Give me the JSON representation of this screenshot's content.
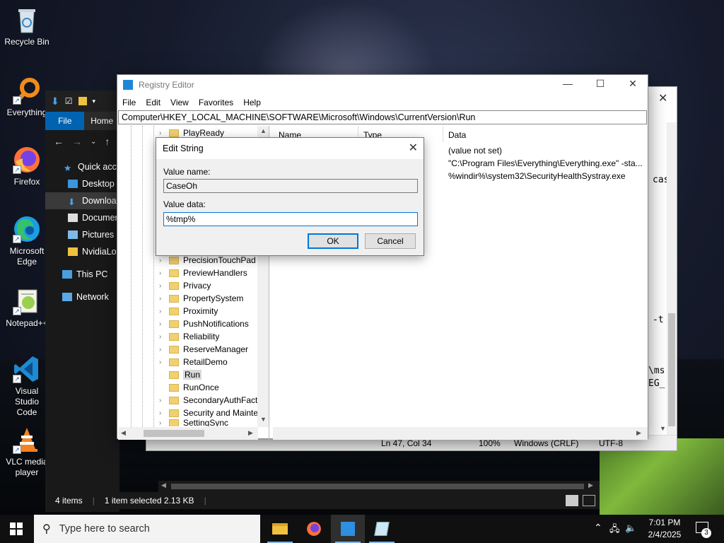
{
  "desktop": {
    "icons": [
      {
        "label": "Recycle Bin"
      },
      {
        "label": "Everything"
      },
      {
        "label": "Firefox"
      },
      {
        "label": "Microsoft Edge"
      },
      {
        "label": "Notepad++"
      },
      {
        "label": "Visual Studio Code"
      },
      {
        "label": "VLC media player"
      }
    ]
  },
  "explorer": {
    "file_tab": "File",
    "home_tab": "Home",
    "sidebar": [
      {
        "label": "Quick access"
      },
      {
        "label": "Desktop"
      },
      {
        "label": "Downloads"
      },
      {
        "label": "Documents"
      },
      {
        "label": "Pictures"
      },
      {
        "label": "NvidiaLogs"
      },
      {
        "label": "This PC"
      },
      {
        "label": "Network"
      }
    ],
    "status": {
      "items": "4 items",
      "selected": "1 item selected  2.13 KB"
    }
  },
  "notepad": {
    "fragments": [
      "cas",
      "-t",
      "\\ms",
      "EG_"
    ],
    "status": {
      "position": "Ln 47, Col 34",
      "zoom": "100%",
      "eol": "Windows (CRLF)",
      "encoding": "UTF-8"
    }
  },
  "regedit": {
    "title": "Registry Editor",
    "menu": [
      "File",
      "Edit",
      "View",
      "Favorites",
      "Help"
    ],
    "address": "Computer\\HKEY_LOCAL_MACHINE\\SOFTWARE\\Microsoft\\Windows\\CurrentVersion\\Run",
    "tree": [
      "PlayReady",
      "PrecisionTouchPad",
      "PreviewHandlers",
      "Privacy",
      "PropertySystem",
      "Proximity",
      "PushNotifications",
      "Reliability",
      "ReserveManager",
      "RetailDemo",
      "Run",
      "RunOnce",
      "SecondaryAuthFact",
      "Security and Mainte",
      "SettingSync"
    ],
    "columns": {
      "name": "Name",
      "type": "Type",
      "data": "Data"
    },
    "data_values": [
      "(value not set)",
      "\"C:\\Program Files\\Everything\\Everything.exe\" -sta...",
      "%windir%\\system32\\SecurityHealthSystray.exe"
    ]
  },
  "dialog": {
    "title": "Edit String",
    "value_name_label": "Value name:",
    "value_name": "CaseOh",
    "value_data_label": "Value data:",
    "value_data": "%tmp%",
    "ok": "OK",
    "cancel": "Cancel"
  },
  "taskbar": {
    "search_placeholder": "Type here to search",
    "time": "7:01 PM",
    "date": "2/4/2025",
    "notification_count": "3"
  }
}
